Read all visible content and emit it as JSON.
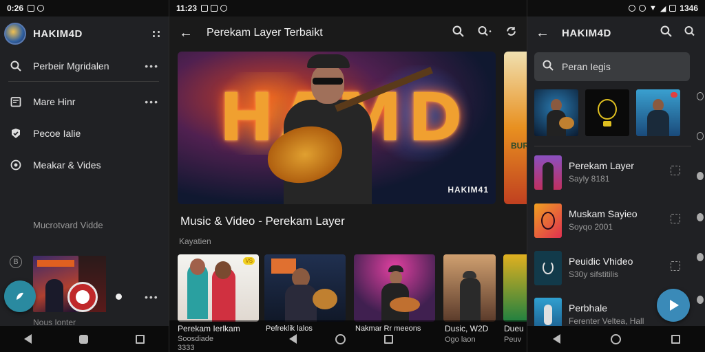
{
  "panel1": {
    "status_time": "0:26",
    "title": "HAKIM4D",
    "menu": [
      {
        "label": "Perbeir Mgridalen",
        "icon": "search-icon"
      },
      {
        "label": "Mare Hinr",
        "icon": "calendar-icon"
      },
      {
        "label": "Pecoe Ialie",
        "icon": "check-badge-icon"
      },
      {
        "label": "Meakar & Vides",
        "icon": "radio-icon"
      }
    ],
    "caption": "Mucrotvard Vidde",
    "bottom_text": "Nous Ionter"
  },
  "panel2": {
    "status_time": "11:23",
    "title": "Perekam Layer Terbaikt",
    "hero_text": "HAMD",
    "hero_watermark": "HAKIM41",
    "peek_text": "BUR",
    "section_title": "Music & Video - Perekam Layer",
    "section_sub": "Kayatien",
    "cards": [
      {
        "title": "Perekam Ierlkam",
        "sub": "Soosdiade",
        "sub2": "3333"
      },
      {
        "title": "Pefreklik lalos",
        "sub": "",
        "sub2": ""
      },
      {
        "title": "Nakmar Rr meeons",
        "sub": "",
        "sub2": ""
      },
      {
        "title": "Dusic, W2D",
        "sub": "Ogo laon",
        "sub2": ""
      },
      {
        "title": "Dueu",
        "sub": "Peuv",
        "sub2": ""
      }
    ],
    "card_badge": "VS"
  },
  "panel3": {
    "status_time": "1346",
    "title": "HAKIM4D",
    "search_placeholder": "Peran Iegis",
    "list": [
      {
        "title": "Perekam Layer",
        "sub": "Sayly 8181"
      },
      {
        "title": "Muskam Sayieo",
        "sub": "Soyqo 2001"
      },
      {
        "title": "Peuidic Vhideo",
        "sub": "S30y sifstitilis"
      },
      {
        "title": "Perbhale",
        "sub": "Ferenter Veltea, Hall"
      }
    ]
  },
  "colors": {
    "accent_teal": "#2a8aa0",
    "record_red": "#c0282a",
    "play_blue": "#3a8ab8"
  }
}
